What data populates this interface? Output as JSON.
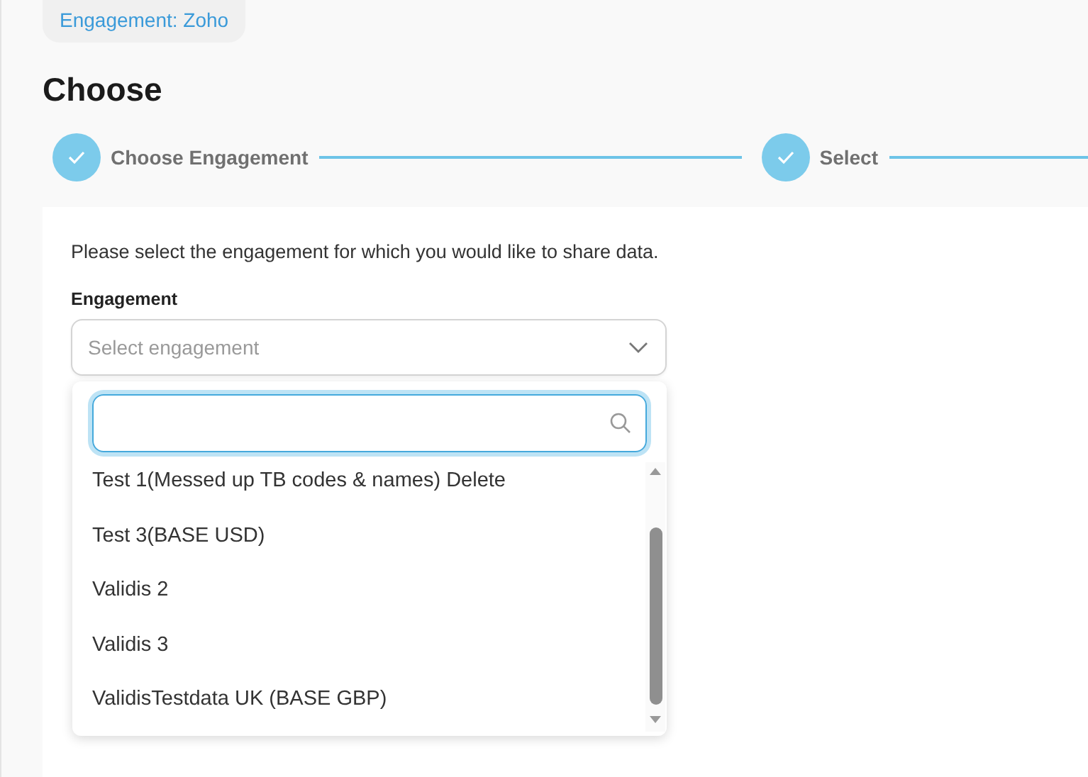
{
  "breadcrumb": "Engagement: Zoho",
  "title": "Choose",
  "steps": [
    {
      "label": "Choose Engagement",
      "done": true
    },
    {
      "label": "Select",
      "done": true
    }
  ],
  "intro": "Please select the engagement for which you would like to share data.",
  "field": {
    "label": "Engagement",
    "placeholder": "Select engagement",
    "expanded": true
  },
  "dropdown": {
    "options": [
      "Test 1(Messed up TB codes & names) Delete",
      "Test 3(BASE USD)",
      "Validis 2",
      "Validis 3",
      "ValidisTestdata UK (BASE GBP)"
    ]
  }
}
